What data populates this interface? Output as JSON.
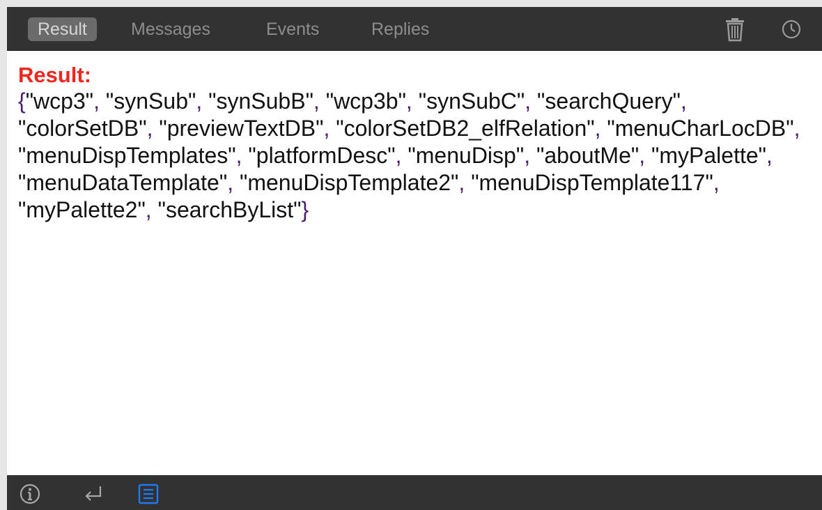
{
  "toolbar": {
    "tabs": [
      {
        "label": "Result",
        "active": true
      },
      {
        "label": "Messages",
        "active": false
      },
      {
        "label": "Events",
        "active": false
      },
      {
        "label": "Replies",
        "active": false
      }
    ],
    "icons": [
      "trash-icon",
      "clock-icon"
    ]
  },
  "result": {
    "label": "Result:",
    "open_brace": "{",
    "close_brace": "}",
    "items": [
      "wcp3",
      "synSub",
      "synSubB",
      "wcp3b",
      "synSubC",
      "searchQuery",
      "colorSetDB",
      "previewTextDB",
      "colorSetDB2_elfRelation",
      "menuCharLocDB",
      "menuDispTemplates",
      "platformDesc",
      "menuDisp",
      "aboutMe",
      "myPalette",
      "menuDataTemplate",
      "menuDispTemplate2",
      "menuDispTemplate117",
      "myPalette2",
      "searchByList"
    ]
  },
  "statusbar": {
    "icons": [
      "info-icon",
      "return-icon",
      "list-icon"
    ]
  },
  "colors": {
    "toolbar_bg": "#323232",
    "active_tab_bg": "#6b6b6b",
    "result_label": "#f0271f",
    "accent_blue": "#1e7bf2",
    "punctuation": "#4a1d6e"
  }
}
